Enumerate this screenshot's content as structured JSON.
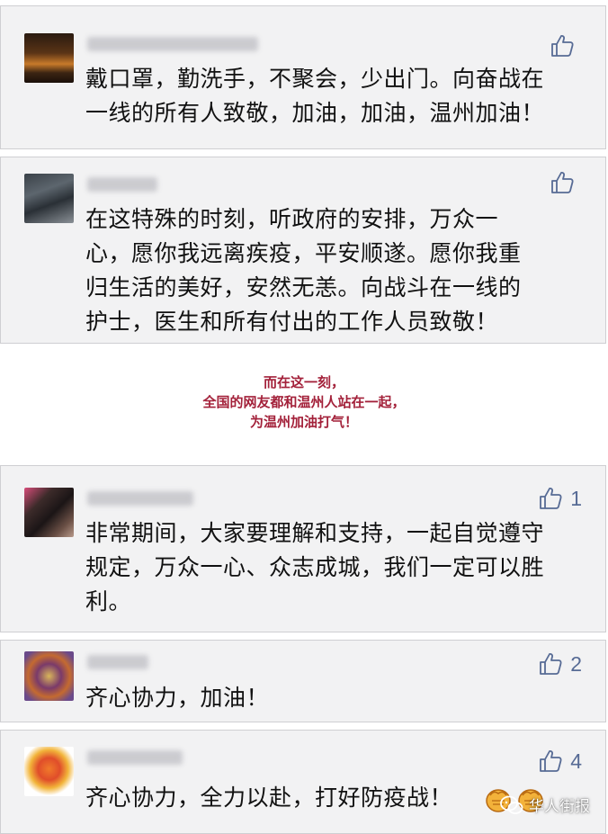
{
  "colors": {
    "card_bg": "#f2f2f3",
    "like_blue": "#576b95",
    "banner_red": "#a3213a",
    "text": "#111111"
  },
  "comments": [
    {
      "text_lines": [
        "戴口罩，勤洗手，不聚会，少出门。向奋战在",
        "一线的所有人致敬，加油，加油，温州加油！"
      ],
      "likes": "",
      "icon": "thumbs-up-icon"
    },
    {
      "text_lines": [
        "在这特殊的时刻，听政府的安排，万众一",
        "心，愿你我远离疾疫，平安顺遂。愿你我重",
        "归生活的美好，安然无恙。向战斗在一线的",
        "护士，医生和所有付出的工作人员致敬！"
      ],
      "likes": "",
      "icon": "thumbs-up-icon"
    },
    {
      "text_lines": [
        "非常期间，大家要理解和支持，一起自觉遵守",
        "规定，万众一心、众志成城，我们一定可以胜",
        "利。"
      ],
      "likes": "1",
      "icon": "thumbs-up-icon"
    },
    {
      "text_lines": [
        "齐心协力，加油！"
      ],
      "likes": "2",
      "icon": "thumbs-up-icon"
    },
    {
      "text_lines": [
        "齐心协力，全力以赴，打好防疫战！"
      ],
      "likes": "4",
      "icon": "thumbs-up-icon"
    }
  ],
  "banner": {
    "line1": "而在这一刻，",
    "line2": "全国的网友都和温州人站在一起，",
    "line3": "为温州加油打气！"
  },
  "watermark": {
    "text": "华人街报",
    "icon": "wechat-icon"
  }
}
